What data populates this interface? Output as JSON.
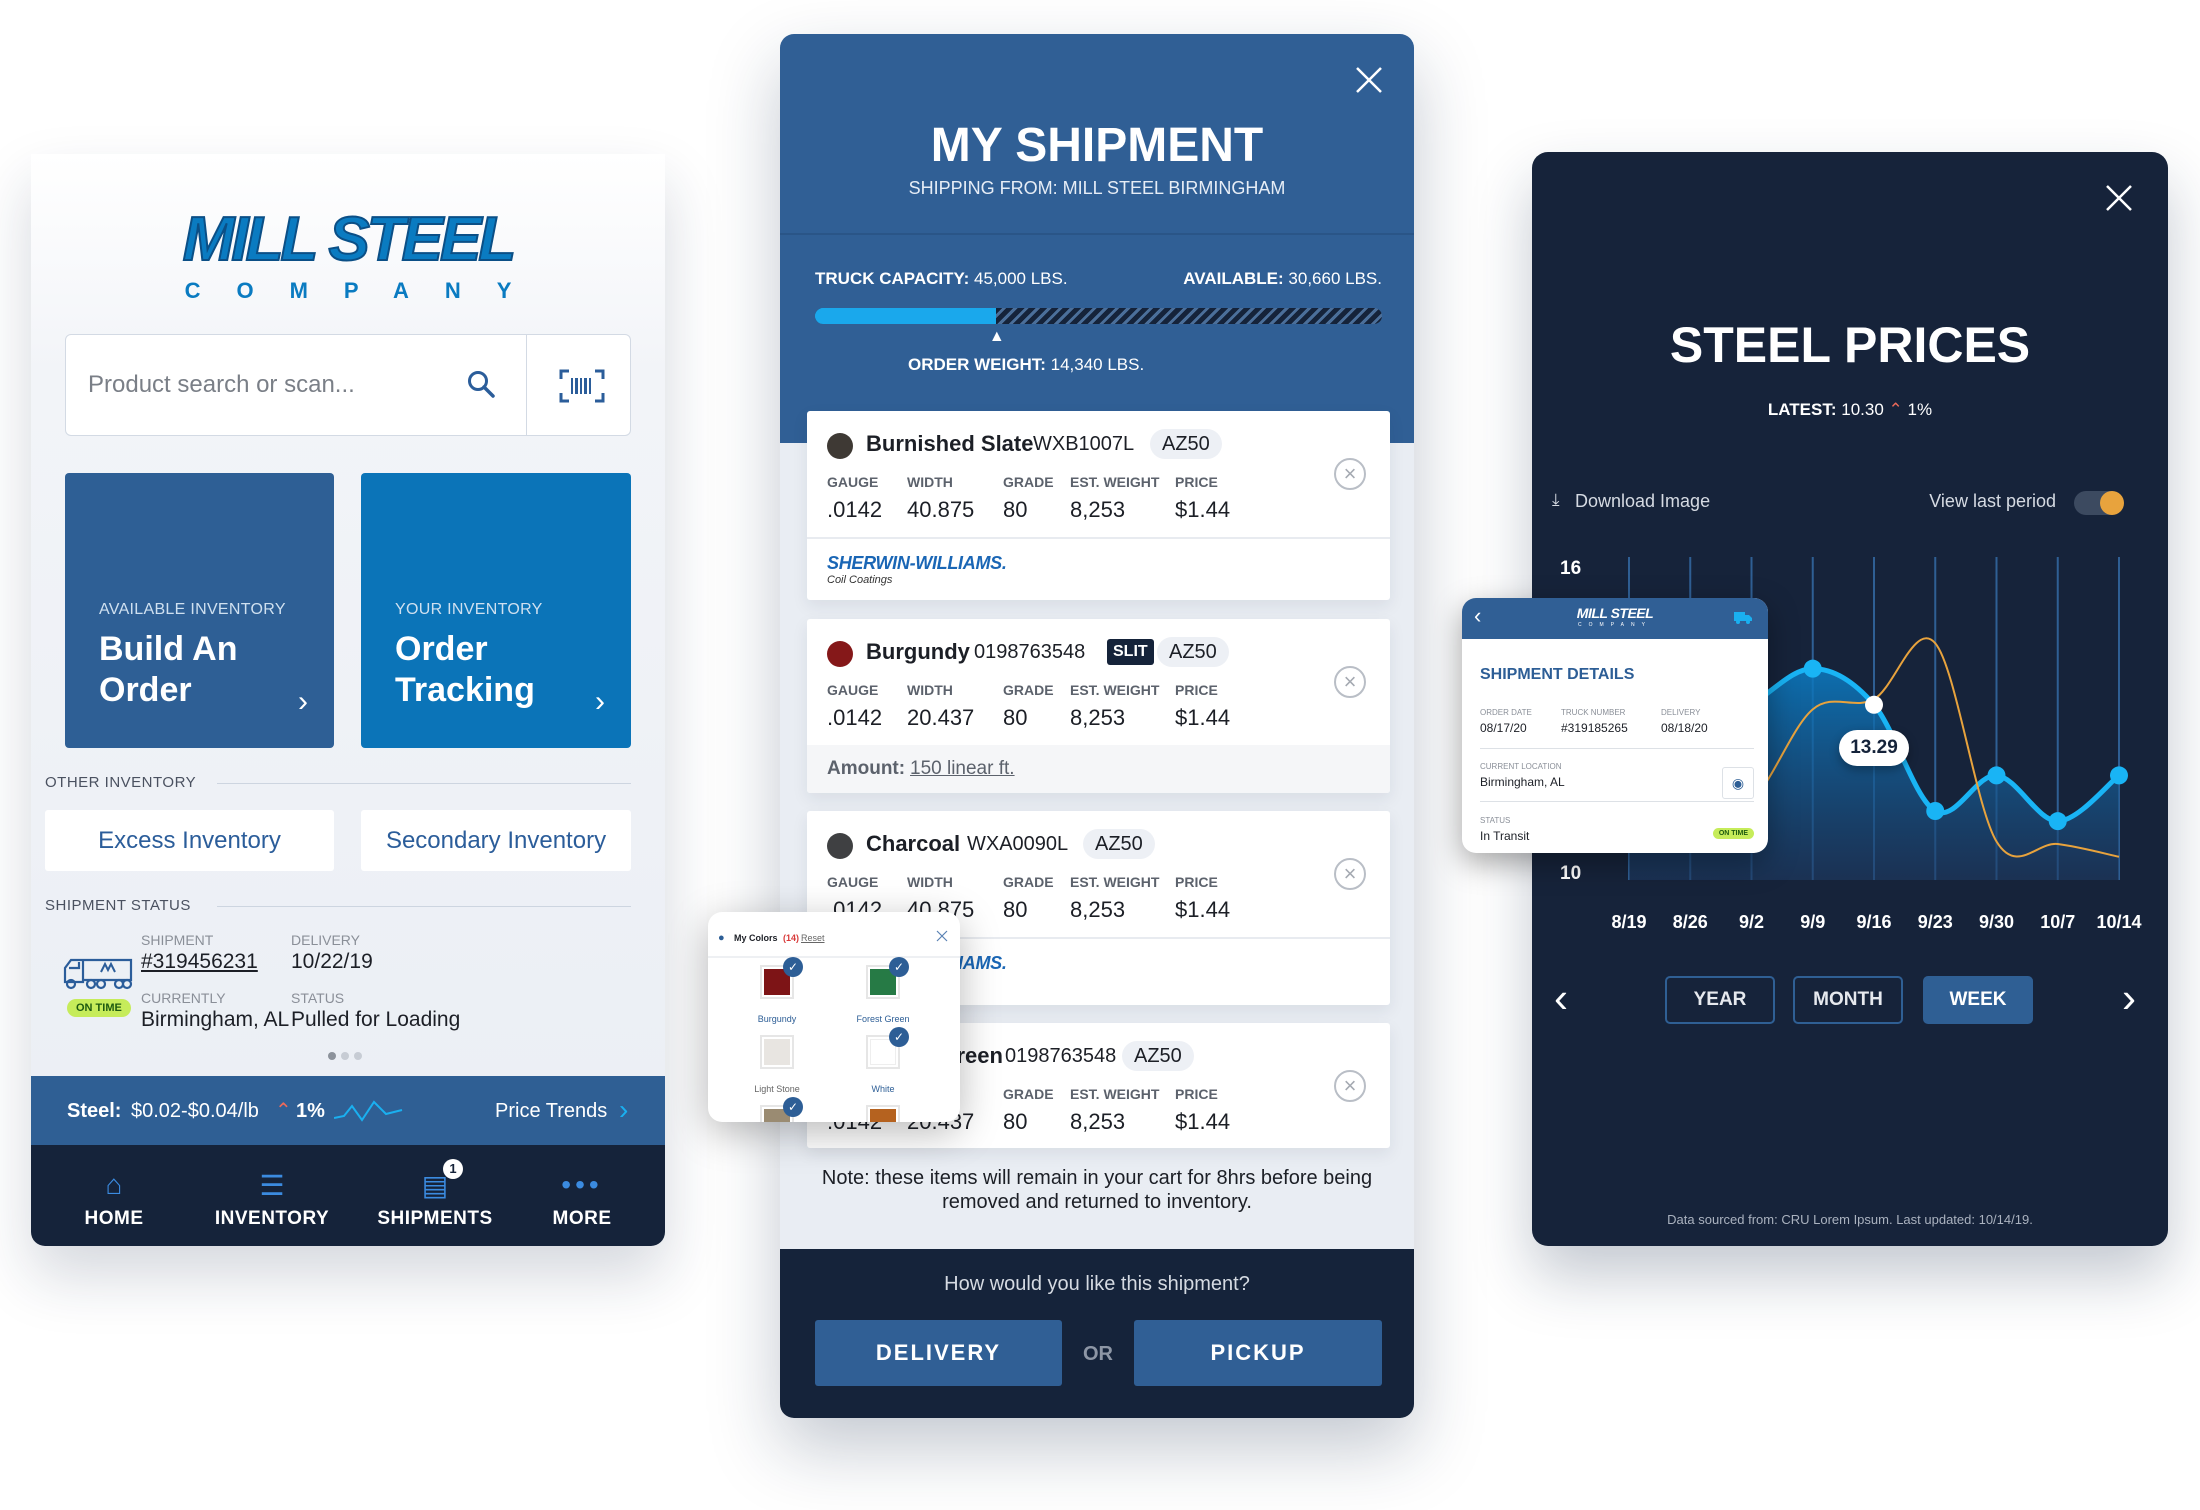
{
  "colors": {
    "brand_blue": "#305f95",
    "navy": "#15233a",
    "accent": "#1ab0f0",
    "orange": "#e8a33d",
    "on_time": "#c6ec5a"
  },
  "home": {
    "logo": {
      "main": "MILL STEEL",
      "sub": "COMPANY"
    },
    "search": {
      "placeholder": "Product search or scan...",
      "search_icon": "search-icon",
      "scan_icon": "barcode-scan-icon"
    },
    "tiles": [
      {
        "label": "AVAILABLE INVENTORY",
        "title_line1": "Build An",
        "title_line2": "Order",
        "color": "#2e5f95"
      },
      {
        "label": "YOUR INVENTORY",
        "title_line1": "Order",
        "title_line2": "Tracking",
        "color": "#0b74b8"
      }
    ],
    "other_inventory": {
      "label": "OTHER INVENTORY",
      "buttons": [
        "Excess Inventory",
        "Secondary Inventory"
      ]
    },
    "shipment_status": {
      "label": "SHIPMENT STATUS",
      "badge": "ON TIME",
      "shipment_label": "SHIPMENT",
      "shipment_value": "#319456231",
      "delivery_label": "DELIVERY",
      "delivery_value": "10/22/19",
      "currently_label": "CURRENTLY",
      "currently_value": "Birmingham, AL",
      "status_label": "STATUS",
      "status_value": "Pulled for Loading",
      "page": 1,
      "pages": 3
    },
    "price_bar": {
      "label": "Steel:",
      "range": "$0.02-$0.04/lb",
      "change": "1%",
      "link": "Price Trends"
    },
    "nav": [
      {
        "label": "HOME",
        "icon": "home-icon"
      },
      {
        "label": "INVENTORY",
        "icon": "list-icon"
      },
      {
        "label": "SHIPMENTS",
        "icon": "receipt-icon",
        "badge": "1"
      },
      {
        "label": "MORE",
        "icon": "more-icon"
      }
    ]
  },
  "shipment": {
    "title": "MY SHIPMENT",
    "subtitle": "SHIPPING FROM: MILL STEEL BIRMINGHAM",
    "capacity_label": "TRUCK CAPACITY:",
    "capacity_value": "45,000 LBS.",
    "available_label": "AVAILABLE:",
    "available_value": "30,660 LBS.",
    "order_weight_label": "ORDER WEIGHT:",
    "order_weight_value": "14,340 LBS.",
    "fill_fraction": 0.319,
    "field_labels": {
      "gauge": "GAUGE",
      "width": "WIDTH",
      "grade": "GRADE",
      "weight": "EST. WEIGHT",
      "price": "PRICE"
    },
    "items": [
      {
        "name": "Burnished Slate",
        "swatch": "#3e3934",
        "code": "WXB1007L",
        "tag": "AZ50",
        "gauge": ".0142",
        "width": "40.875",
        "grade": "80",
        "weight": "8,253",
        "price": "$1.44",
        "brand": "SHERWIN-WILLIAMS.",
        "brand_sub": "Coil Coatings"
      },
      {
        "name": "Burgundy",
        "swatch": "#851819",
        "code": "0198763548",
        "badge": "SLIT",
        "tag": "AZ50",
        "gauge": ".0142",
        "width": "20.437",
        "grade": "80",
        "weight": "8,253",
        "price": "$1.44",
        "amount_label": "Amount:",
        "amount_value": "150 linear ft."
      },
      {
        "name": "Charcoal",
        "swatch": "#3f4042",
        "code": "WXA0090L",
        "tag": "AZ50",
        "gauge": ".0142",
        "width": "40.875",
        "grade": "80",
        "weight": "8,253",
        "price": "$1.44",
        "brand": "SHERWIN-WILLIAMS."
      },
      {
        "name": "Forest Green",
        "swatch": "#267a45",
        "code": "0198763548",
        "tag": "AZ50",
        "gauge": ".0142",
        "width": "20.437",
        "grade": "80",
        "weight": "8,253",
        "price": "$1.44"
      }
    ],
    "note": "Note: these items will remain in your cart for 8hrs before being removed and returned to inventory.",
    "question": "How would you like this shipment?",
    "delivery_button": "DELIVERY",
    "or": "OR",
    "pickup_button": "PICKUP"
  },
  "colors_popup": {
    "title": "My Colors",
    "count": "(14)",
    "reset": "Reset",
    "swatches": [
      {
        "name": "Burgundy",
        "color": "#7d1416",
        "checked": true
      },
      {
        "name": "Forest Green",
        "color": "#267a45",
        "checked": true
      },
      {
        "name": "Light Stone",
        "color": "#e8e5e1",
        "checked": false
      },
      {
        "name": "White",
        "color": "#ffffff",
        "checked": true
      },
      {
        "color": "#9a8b72",
        "checked": true
      },
      {
        "color": "#b5621f",
        "checked": false
      }
    ]
  },
  "prices": {
    "title": "STEEL PRICES",
    "latest_label": "LATEST:",
    "latest_value": "10.30",
    "latest_change": "1%",
    "download": "Download Image",
    "view_last_period": "View last period",
    "view_last_period_on": true,
    "periods": [
      "YEAR",
      "MONTH",
      "WEEK"
    ],
    "active_period": "WEEK",
    "footnote": "Data sourced from: CRU Lorem Ipsum. Last updated: 10/14/19.",
    "tooltip": "13.29"
  },
  "chart_data": {
    "type": "area",
    "categories": [
      "8/19",
      "8/26",
      "9/2",
      "9/9",
      "9/16",
      "9/23",
      "9/30",
      "10/7",
      "10/14"
    ],
    "series": [
      {
        "values": [
          12.0,
          12.6,
          13.3,
          14.0,
          13.29,
          11.2,
          11.9,
          11.0,
          11.9
        ],
        "color": "#19b4f5",
        "style": "area"
      },
      {
        "values": [
          11.0,
          11.1,
          11.4,
          13.2,
          13.4,
          14.5,
          10.6,
          10.55,
          10.3
        ],
        "color": "#e8a33d",
        "style": "line"
      }
    ],
    "y_tick_labels": [
      "16",
      "10"
    ],
    "ylim": [
      10,
      16
    ],
    "selected_category": "9/16",
    "grid": "vertical",
    "legend": "none"
  },
  "ship_details": {
    "logo": "MILL STEEL",
    "logo_sub": "COMPANY",
    "title": "SHIPMENT DETAILS",
    "order_date_label": "ORDER DATE",
    "order_date": "08/17/20",
    "truck_label": "TRUCK NUMBER",
    "truck": "#319185265",
    "delivery_label": "DELIVERY",
    "delivery": "08/18/20",
    "location_label": "CURRENT LOCATION",
    "location": "Birmingham, AL",
    "status_label": "STATUS",
    "status": "In Transit",
    "badge": "ON TIME"
  }
}
